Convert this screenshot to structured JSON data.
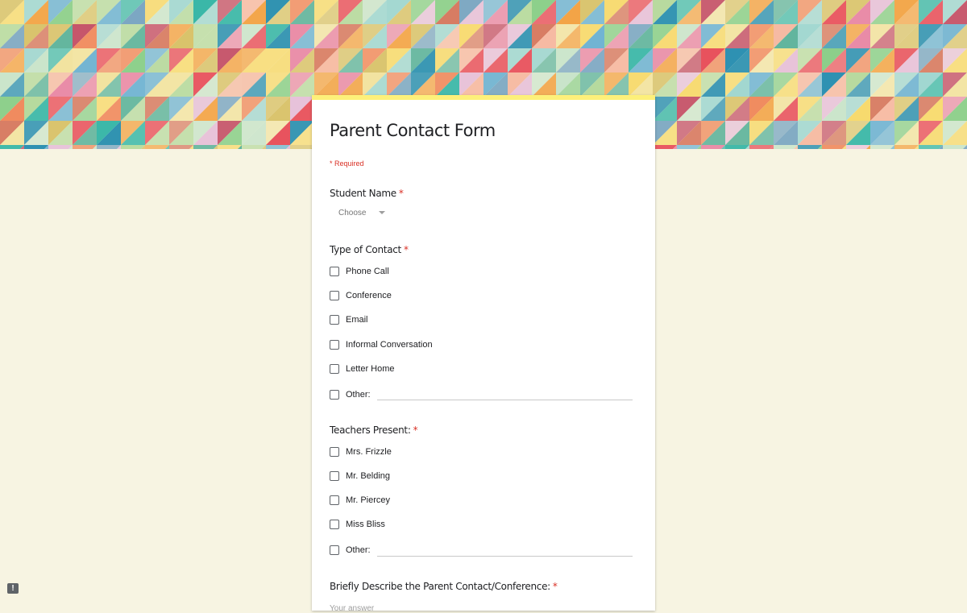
{
  "form": {
    "title": "Parent Contact Form",
    "required_note": "* Required",
    "required_marker": "*",
    "student_name": {
      "label": "Student Name",
      "dropdown_value": "Choose"
    },
    "type_of_contact": {
      "label": "Type of Contact",
      "options": [
        "Phone Call",
        "Conference",
        "Email",
        "Informal Conversation",
        "Letter Home",
        "Other:"
      ]
    },
    "teachers_present": {
      "label": "Teachers Present:",
      "options": [
        "Mrs. Frizzle",
        "Mr. Belding",
        "Mr. Piercey",
        "Miss Bliss",
        "Other:"
      ]
    },
    "description": {
      "label": "Briefly Describe the Parent Contact/Conference:",
      "placeholder": "Your answer"
    }
  },
  "colors": {
    "page_background": "#f7f4e2",
    "card_top_border": "#fdf07a",
    "required_red": "#d93025"
  },
  "icons": {
    "report": "report-problem-icon"
  }
}
